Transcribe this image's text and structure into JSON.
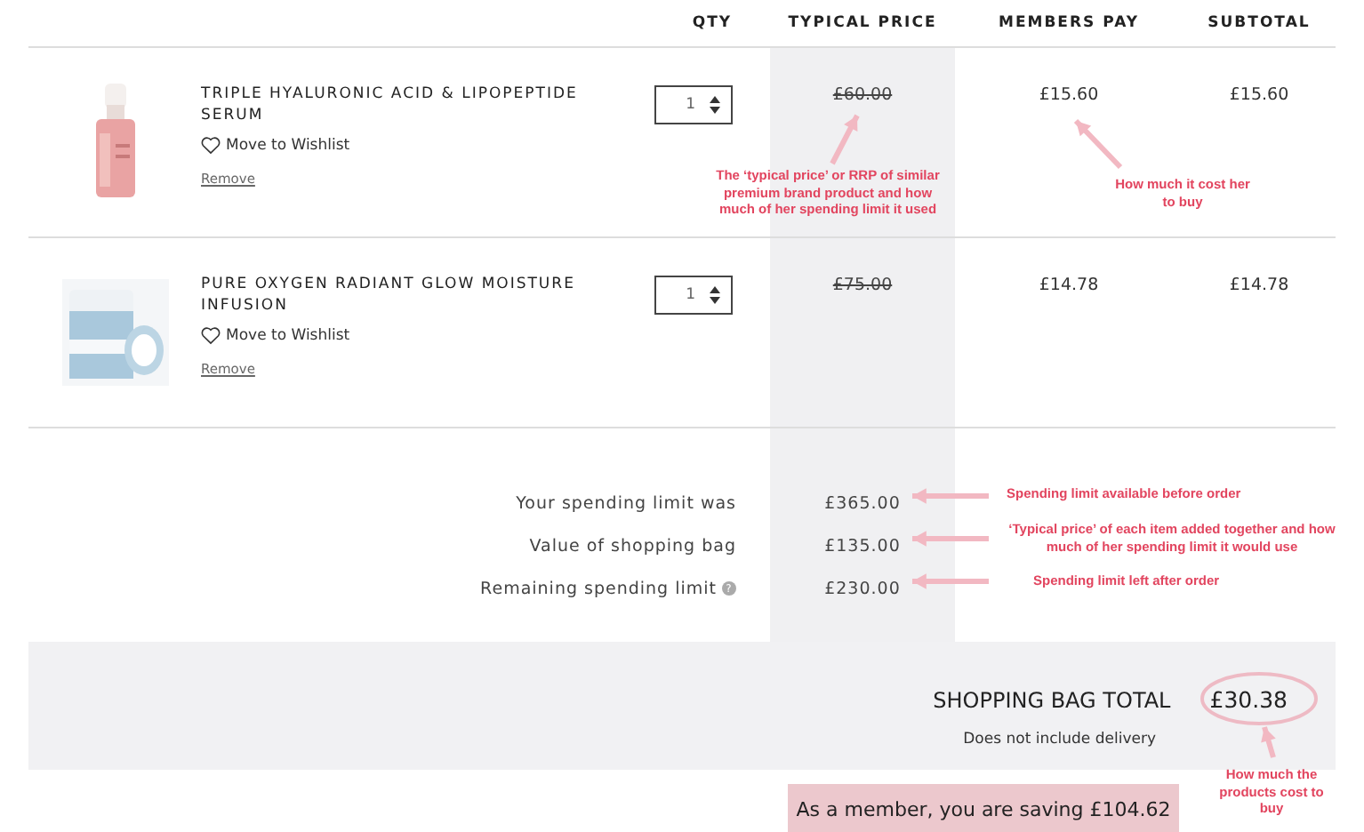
{
  "columns": [
    {
      "label": "QTY"
    },
    {
      "label": "TYPICAL PRICE"
    },
    {
      "label": "MEMBERS PAY"
    },
    {
      "label": "SUBTOTAL"
    }
  ],
  "items": [
    {
      "name": "TRIPLE HYALURONIC ACID & LIPOPEPTIDE SERUM",
      "kind": "bottle",
      "wishlist": "Move to Wishlist",
      "remove": "Remove",
      "qty": "1",
      "typical_price": "£60.00",
      "members_pay": "£15.60",
      "subtotal": "£15.60"
    },
    {
      "name": "PURE OXYGEN RADIANT GLOW MOISTURE INFUSION",
      "kind": "jars",
      "wishlist": "Move to Wishlist",
      "remove": "Remove",
      "qty": "1",
      "typical_price": "£75.00",
      "members_pay": "£14.78",
      "subtotal": "£14.78"
    }
  ],
  "summary": [
    {
      "label": "Your spending limit was",
      "value": "£365.00"
    },
    {
      "label": "Value of shopping bag",
      "value": "£135.00"
    },
    {
      "label": "Remaining spending limit",
      "value": "£230.00",
      "help_icon": "?"
    }
  ],
  "total": {
    "label": "SHOPPING BAG TOTAL",
    "value": "£30.38",
    "note": "Does not include delivery"
  },
  "saving_banner": "As a member, you are saving £104.62",
  "annotations": [
    {
      "text": "The ‘typical price’ or RRP of similar\npremium brand product and how\nmuch of her spending limit it used"
    },
    {
      "text": "How much it cost her\nto buy"
    },
    {
      "text": "Spending limit available before order"
    },
    {
      "text": "‘Typical price’ of each item added together and how\nmuch of her spending limit it would use"
    },
    {
      "text": "Spending limit left after order"
    },
    {
      "text": "How much the\nproducts cost to\nbuy"
    }
  ]
}
